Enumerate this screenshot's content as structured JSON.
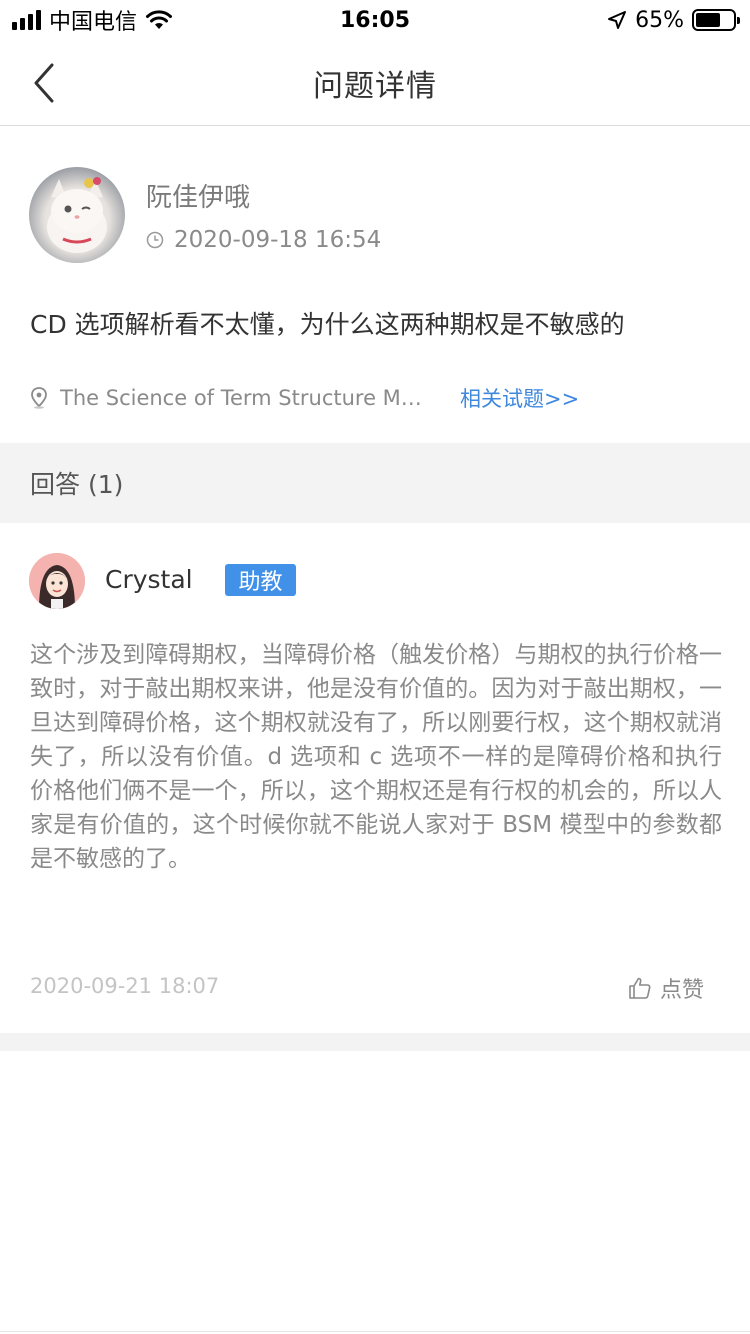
{
  "status_bar": {
    "carrier": "中国电信",
    "time": "16:05",
    "battery": "65%"
  },
  "nav": {
    "title": "问题详情"
  },
  "question": {
    "author": "阮佳伊哦",
    "time": "2020-09-18 16:54",
    "text": "CD 选项解析看不太懂，为什么这两种期权是不敏感的",
    "source": "The Science of Term Structure Models",
    "related_link": "相关试题>>"
  },
  "answers": {
    "header": "回答 (1)",
    "items": [
      {
        "author": "Crystal",
        "badge": "助教",
        "text": "这个涉及到障碍期权，当障碍价格（触发价格）与期权的执行价格一致时，对于敲出期权来讲，他是没有价值的。因为对于敲出期权，一旦达到障碍价格，这个期权就没有了，所以刚要行权，这个期权就消失了，所以没有价值。d 选项和 c 选项不一样的是障碍价格和执行价格他们俩不是一个，所以，这个期权还是有行权的机会的，所以人家是有价值的，这个时候你就不能说人家对于 BSM 模型中的参数都是不敏感的了。",
        "time": "2020-09-21 18:07",
        "like_label": "点赞"
      }
    ]
  },
  "colors": {
    "accent": "#3f88de",
    "badge": "#4291e8"
  }
}
